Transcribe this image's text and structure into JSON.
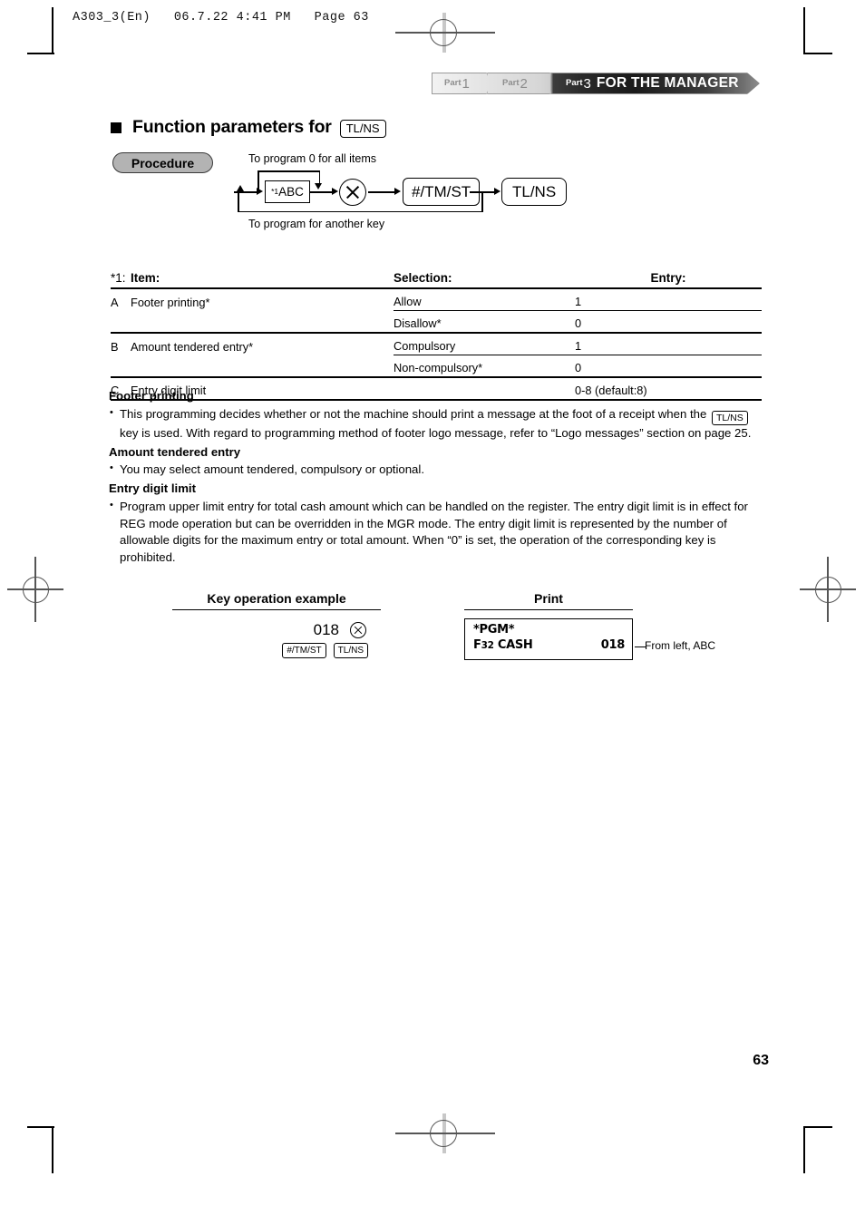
{
  "file_header": "A303_3(En)   06.7.22 4:41 PM   Page 63",
  "banner": {
    "parts": [
      {
        "label": "Part",
        "num": "1"
      },
      {
        "label": "Part",
        "num": "2"
      },
      {
        "label": "Part",
        "num": "3"
      }
    ],
    "title": "FOR THE MANAGER"
  },
  "section": {
    "title": "Function parameters for",
    "key": "TL/NS"
  },
  "procedure": {
    "badge": "Procedure",
    "caption_top": "To program  0  for all items",
    "caption_bottom": "To program for another key",
    "box_label_sup": "*1",
    "box_label": "ABC",
    "key_tm": "#/TM/ST",
    "key_tl": "TL/NS"
  },
  "table": {
    "note": "*1:",
    "headers": {
      "item": "Item:",
      "selection": "Selection:",
      "entry": "Entry:"
    },
    "rows": [
      {
        "ab": "A",
        "item": "Footer printing*",
        "selection": "Allow",
        "entry": "1"
      },
      {
        "ab": "",
        "item": "",
        "selection": "Disallow*",
        "entry": "0"
      },
      {
        "ab": "B",
        "item": "Amount tendered entry*",
        "selection": "Compulsory",
        "entry": "1"
      },
      {
        "ab": "",
        "item": "",
        "selection": "Non-compulsory*",
        "entry": "0"
      },
      {
        "ab": "C",
        "item": "Entry digit limit",
        "selection": "",
        "entry": "0-8 (default:8)"
      }
    ]
  },
  "body": {
    "s1_head": "Footer printing",
    "s1_p1a": "This programming decides whether or not the machine should print a message at the foot of a receipt when the",
    "s1_key": "TL/NS",
    "s1_p1b": "key is used.  With regard to programming method of footer logo message, refer to “Logo messages” section on page 25.",
    "s2_head": "Amount tendered entry",
    "s2_p1": "You may select amount tendered, compulsory or optional.",
    "s3_head": "Entry digit limit",
    "s3_p1": "Program upper limit entry for total cash amount which can be handled on the register.  The entry digit limit is in effect for REG mode operation but can be overridden in the MGR mode.  The entry digit limit is represented by the number of allowable digits for the maximum entry or total amount.  When “0” is set, the operation of the corresponding key is prohibited."
  },
  "example": {
    "heading": "Key operation example",
    "number": "018",
    "key_tm": "#/TM/ST",
    "key_tl": "TL/NS"
  },
  "print": {
    "heading": "Print",
    "line1": "*PGM*",
    "line2_a": "F",
    "line2_small": "32",
    "line2_b": "CASH",
    "value": "018",
    "annotation": "From left, ABC"
  },
  "page_number": "63"
}
